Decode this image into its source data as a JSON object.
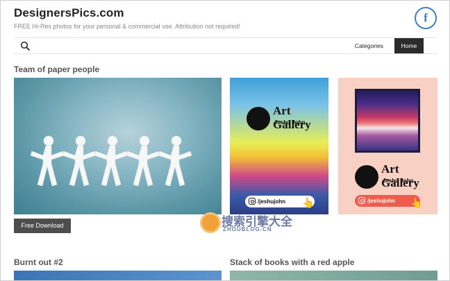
{
  "header": {
    "site_title": "DesignersPics.com",
    "tagline": "FREE Hi-Res photos for your personal & commercial use. Attribution not required!",
    "social_icon": "f"
  },
  "nav": {
    "categories_label": "Categories",
    "home_label": "Home"
  },
  "sections": [
    {
      "title": "Team of paper people",
      "download_label": "Free Download"
    },
    {
      "title": "Burnt out #2"
    },
    {
      "title": "Stack of books with a red apple"
    }
  ],
  "ads": [
    {
      "title": "Art Gallery",
      "subtitle": "Jeshu John",
      "handle": "/jeshujohn"
    },
    {
      "title": "Art Gallery",
      "subtitle": "Jeshu John",
      "handle": "/jeshujohn"
    }
  ],
  "watermark": {
    "text": "搜索引擎大全",
    "url": "ZHOUBLOG.CN"
  },
  "colors": {
    "accent": "#3b7fc4",
    "dark_button": "#2b2b2b",
    "download_button": "#4d4d4d"
  }
}
